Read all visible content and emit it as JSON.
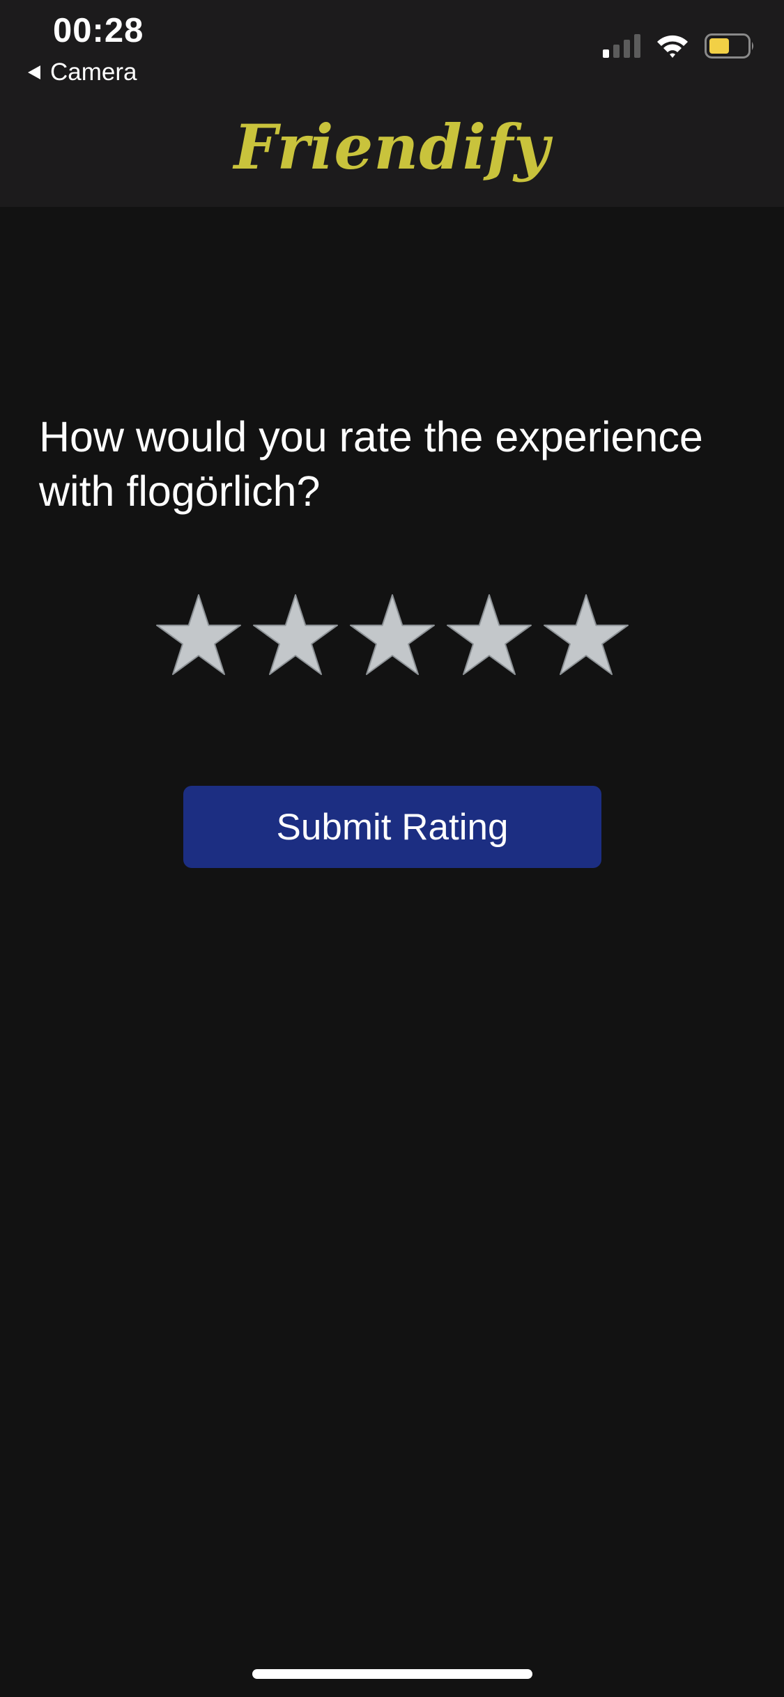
{
  "status_bar": {
    "time": "00:28",
    "back_label": "Camera",
    "icons": [
      "signal-icon",
      "wifi-icon",
      "battery-icon"
    ],
    "battery_color": "#f2d046"
  },
  "header": {
    "logo_text": "Friendify",
    "logo_color": "#c9c33c"
  },
  "rating": {
    "question": "How would you rate the experience with flogörlich?",
    "max_stars": 5,
    "selected_stars": 0,
    "star_color": "#c3c7ca",
    "submit_label": "Submit Rating",
    "submit_color": "#1c2e82"
  }
}
